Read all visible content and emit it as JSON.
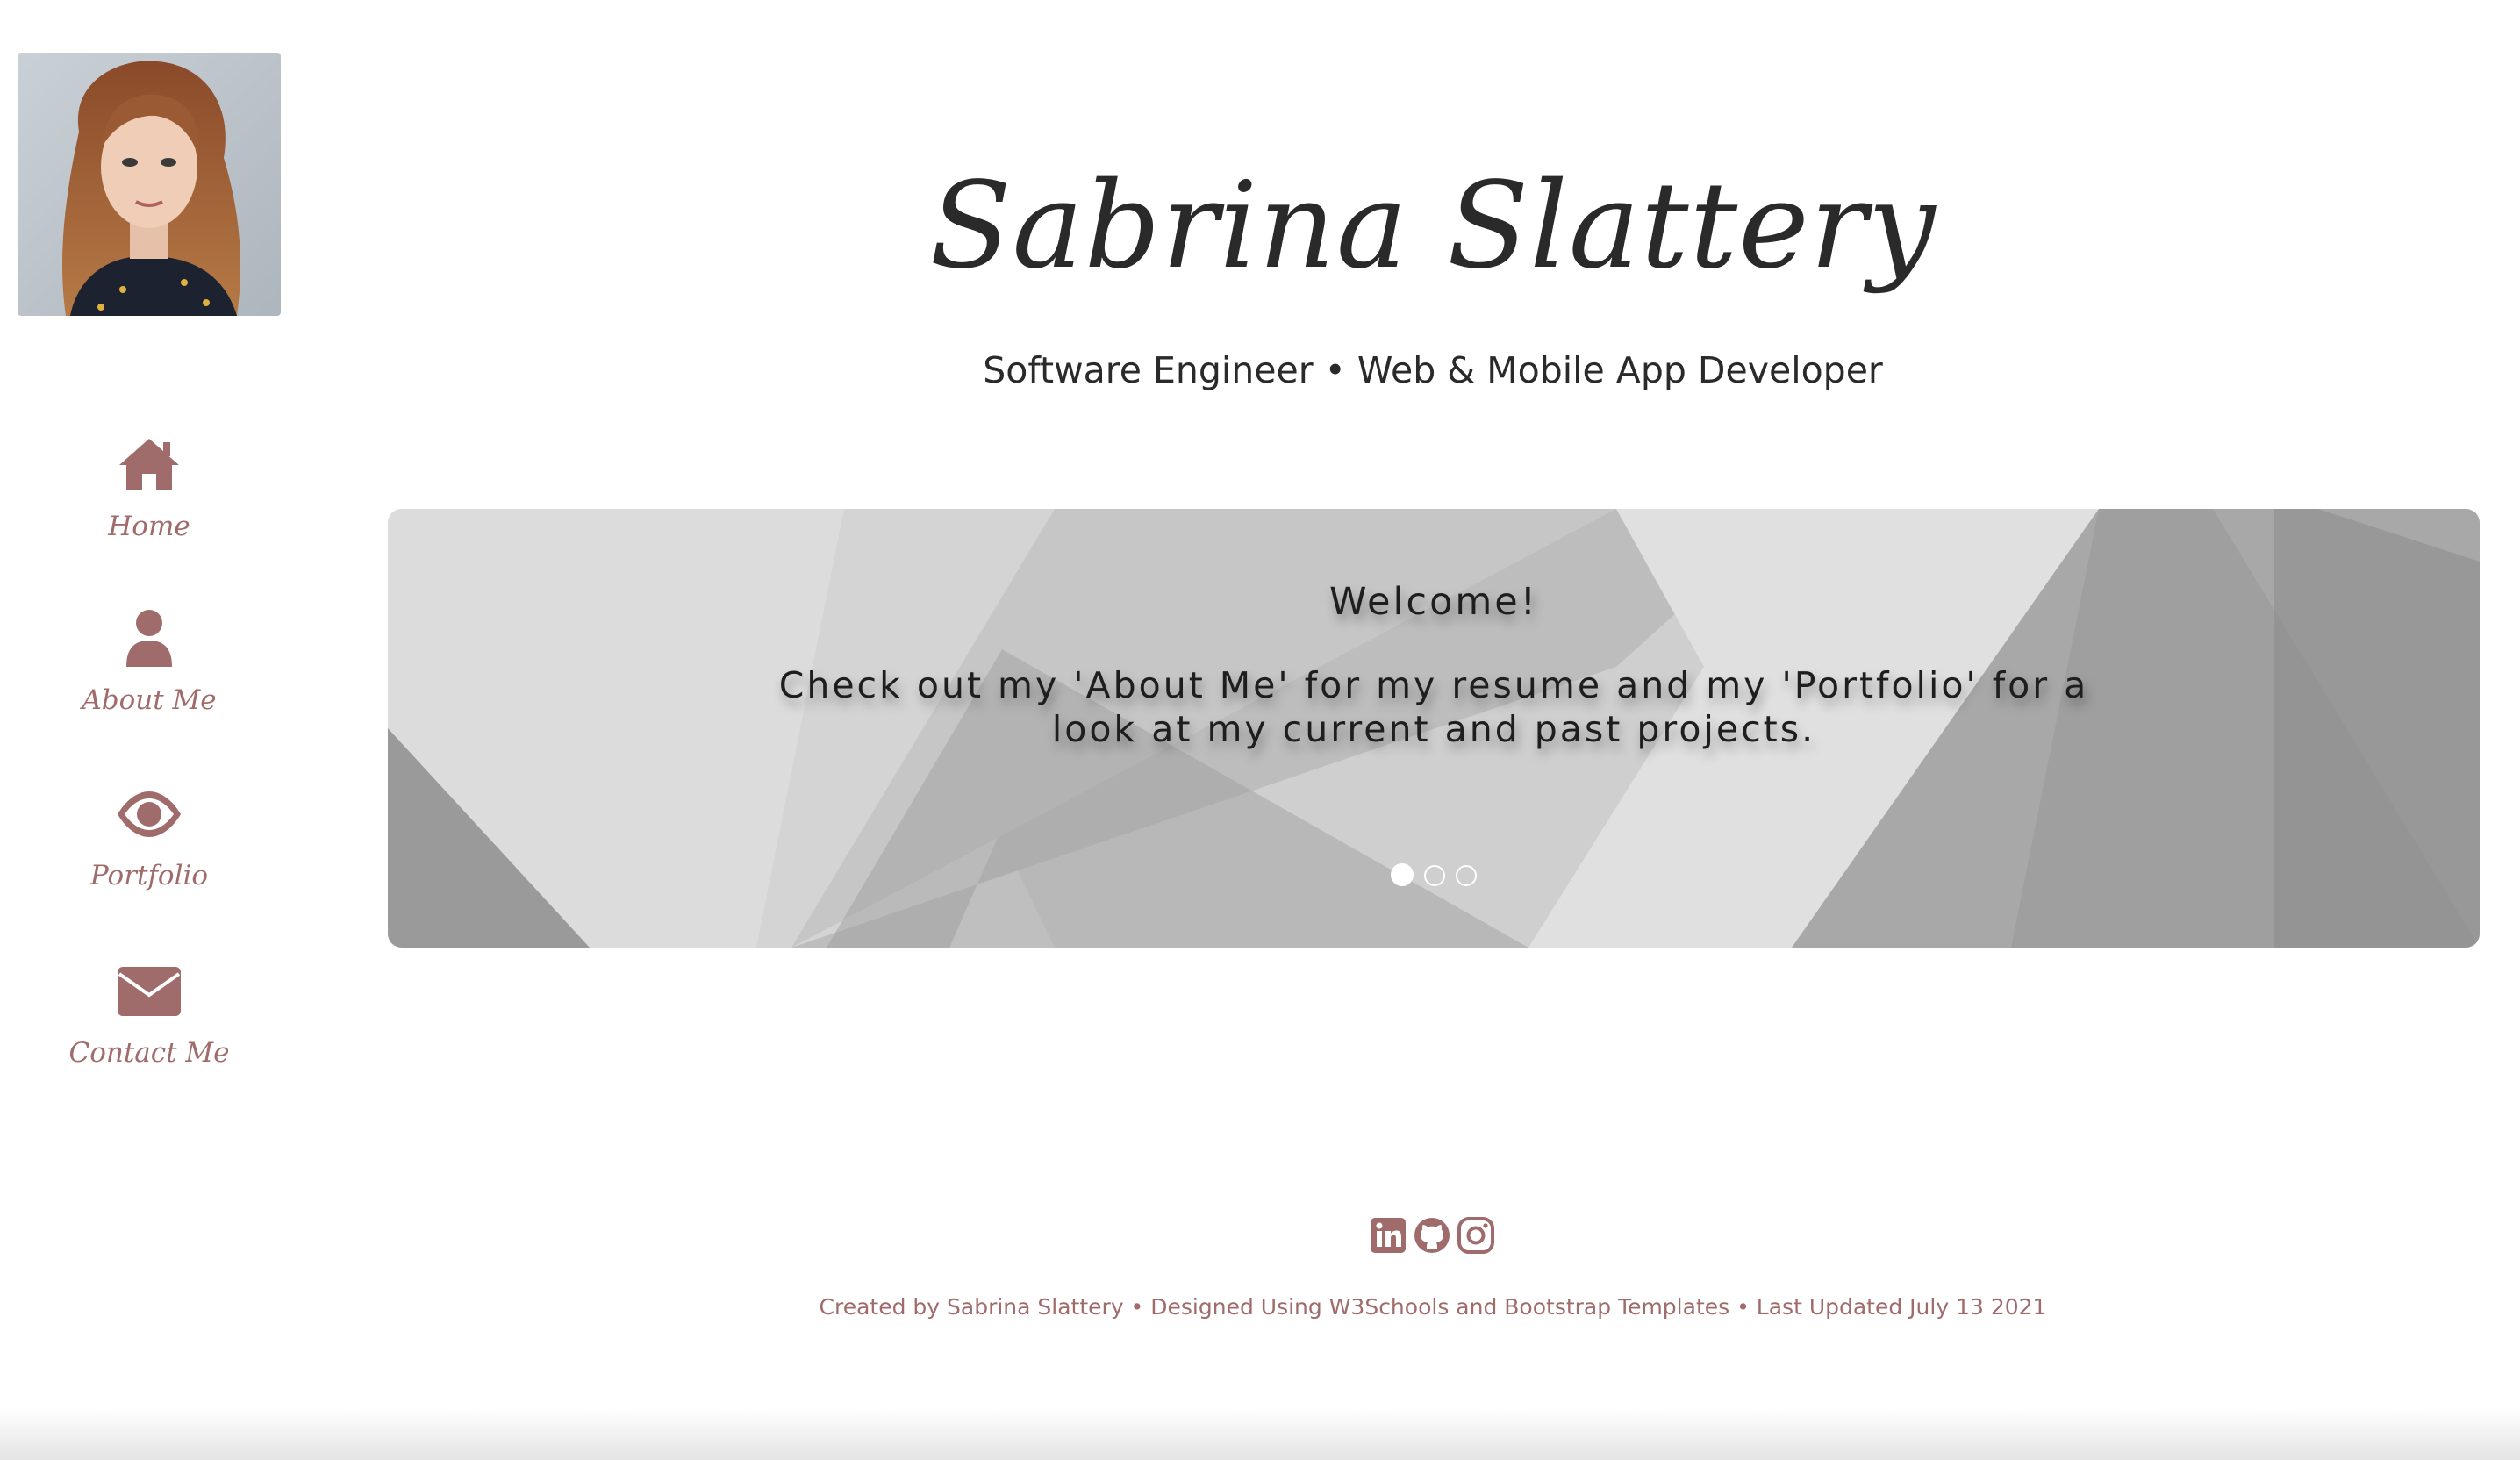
{
  "colors": {
    "accent": "#a06b6b",
    "text_dark": "#2a2a2a",
    "background": "#ffffff"
  },
  "sidebar": {
    "avatar_icon": "profile-photo",
    "items": [
      {
        "label": "Home",
        "icon": "home-icon"
      },
      {
        "label": "About Me",
        "icon": "user-icon"
      },
      {
        "label": "Portfolio",
        "icon": "eye-icon"
      },
      {
        "label": "Contact Me",
        "icon": "envelope-icon"
      }
    ]
  },
  "header": {
    "title": "Sabrina Slattery",
    "subtitle": "Software Engineer • Web & Mobile App Developer"
  },
  "carousel": {
    "heading": "Welcome!",
    "body_line_1": "Check out my 'About Me' for my resume and my 'Portfolio' for a",
    "body_line_2": "look at my current and past projects.",
    "slide_count": 3,
    "active_slide": 1
  },
  "footer": {
    "social_icons": [
      "linkedin-icon",
      "github-icon",
      "instagram-icon"
    ],
    "credits": "Created by Sabrina Slattery • Designed Using W3Schools and Bootstrap Templates • Last Updated July 13 2021"
  }
}
